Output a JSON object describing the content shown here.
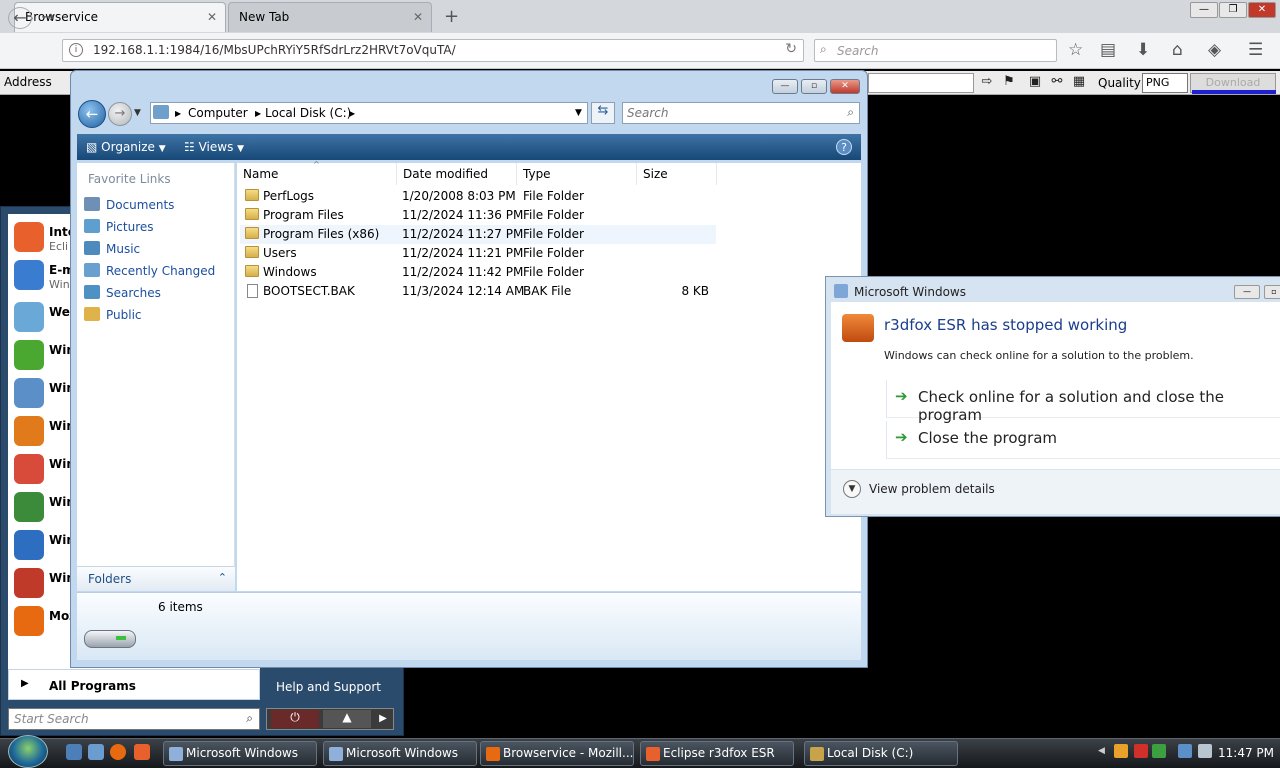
{
  "browser": {
    "tabs": [
      {
        "label": "Browservice",
        "close": "✕"
      },
      {
        "label": "New Tab",
        "close": "✕"
      }
    ],
    "new_tab": "+",
    "url": "192.168.1.1:1984/16/MbsUPchRYiY5RfSdrLrz2HRVt7oVquTA/",
    "search_placeholder": "Search",
    "window_buttons": [
      "—",
      "❐",
      "✕"
    ]
  },
  "address_bar": {
    "label": "Address",
    "quality_label": "Quality",
    "quality_value": "PNG",
    "download_label": "Download"
  },
  "start_menu": {
    "items": [
      {
        "title": "Inte",
        "sub": "Ecli",
        "color": "#e8602c"
      },
      {
        "title": "E-m",
        "sub": "Win",
        "color": "#3a7ccf"
      },
      {
        "title": "Wel",
        "sub": "",
        "color": "#6aa8d8"
      },
      {
        "title": "Win",
        "sub": "",
        "color": "#4aa830"
      },
      {
        "title": "Win",
        "sub": "",
        "color": "#5b8fc8"
      },
      {
        "title": "Win",
        "sub": "",
        "color": "#e07a1a"
      },
      {
        "title": "Win",
        "sub": "",
        "color": "#d84a3a"
      },
      {
        "title": "Win",
        "sub": "",
        "color": "#3b8b3b"
      },
      {
        "title": "Win",
        "sub": "",
        "color": "#2e6ec0"
      },
      {
        "title": "Win",
        "sub": "",
        "color": "#c03a2a"
      },
      {
        "title": "Moz",
        "sub": "",
        "color": "#e86a10"
      }
    ],
    "all_programs": "All Programs",
    "help": "Help and Support",
    "search_placeholder": "Start Search"
  },
  "explorer": {
    "breadcrumb": [
      "Computer",
      "Local Disk (C:)"
    ],
    "search_placeholder": "Search",
    "commands": {
      "organize": "Organize",
      "views": "Views",
      "help": "?"
    },
    "favorite_links_header": "Favorite Links",
    "favorites": [
      {
        "label": "Documents",
        "color": "#6f8fb5"
      },
      {
        "label": "Pictures",
        "color": "#5f9fcf"
      },
      {
        "label": "Music",
        "color": "#4d8bbf"
      },
      {
        "label": "Recently Changed",
        "color": "#6aa0d0"
      },
      {
        "label": "Searches",
        "color": "#4e92c4"
      },
      {
        "label": "Public",
        "color": "#e0b24a"
      }
    ],
    "folders_label": "Folders",
    "columns": [
      "Name",
      "Date modified",
      "Type",
      "Size"
    ],
    "files": [
      {
        "name": "PerfLogs",
        "date": "1/20/2008 8:03 PM",
        "type": "File Folder",
        "size": "",
        "kind": "folder"
      },
      {
        "name": "Program Files",
        "date": "11/2/2024 11:36 PM",
        "type": "File Folder",
        "size": "",
        "kind": "folder"
      },
      {
        "name": "Program Files (x86)",
        "date": "11/2/2024 11:27 PM",
        "type": "File Folder",
        "size": "",
        "kind": "folder"
      },
      {
        "name": "Users",
        "date": "11/2/2024 11:21 PM",
        "type": "File Folder",
        "size": "",
        "kind": "folder"
      },
      {
        "name": "Windows",
        "date": "11/2/2024 11:42 PM",
        "type": "File Folder",
        "size": "",
        "kind": "folder"
      },
      {
        "name": "BOOTSECT.BAK",
        "date": "11/3/2024 12:14 AM",
        "type": "BAK File",
        "size": "8 KB",
        "kind": "file"
      }
    ],
    "item_count": "6 items"
  },
  "crash_dialog": {
    "title": "Microsoft Windows",
    "heading": "r3dfox ESR has stopped working",
    "subtext": "Windows can check online for a solution to the problem.",
    "option_check": "Check online for a solution and close the program",
    "option_close": "Close the program",
    "view_details": "View problem details"
  },
  "taskbar": {
    "tasks": [
      {
        "label": "Microsoft Windows",
        "color": "#8fb0d8"
      },
      {
        "label": "Microsoft Windows",
        "color": "#8fb0d8"
      },
      {
        "label": "Browservice - Mozill...",
        "color": "#e86a10"
      },
      {
        "label": "Eclipse r3dfox ESR",
        "color": "#e8602c"
      },
      {
        "label": "Local Disk (C:)",
        "color": "#c7a34a"
      }
    ],
    "clock": "11:47 PM"
  }
}
